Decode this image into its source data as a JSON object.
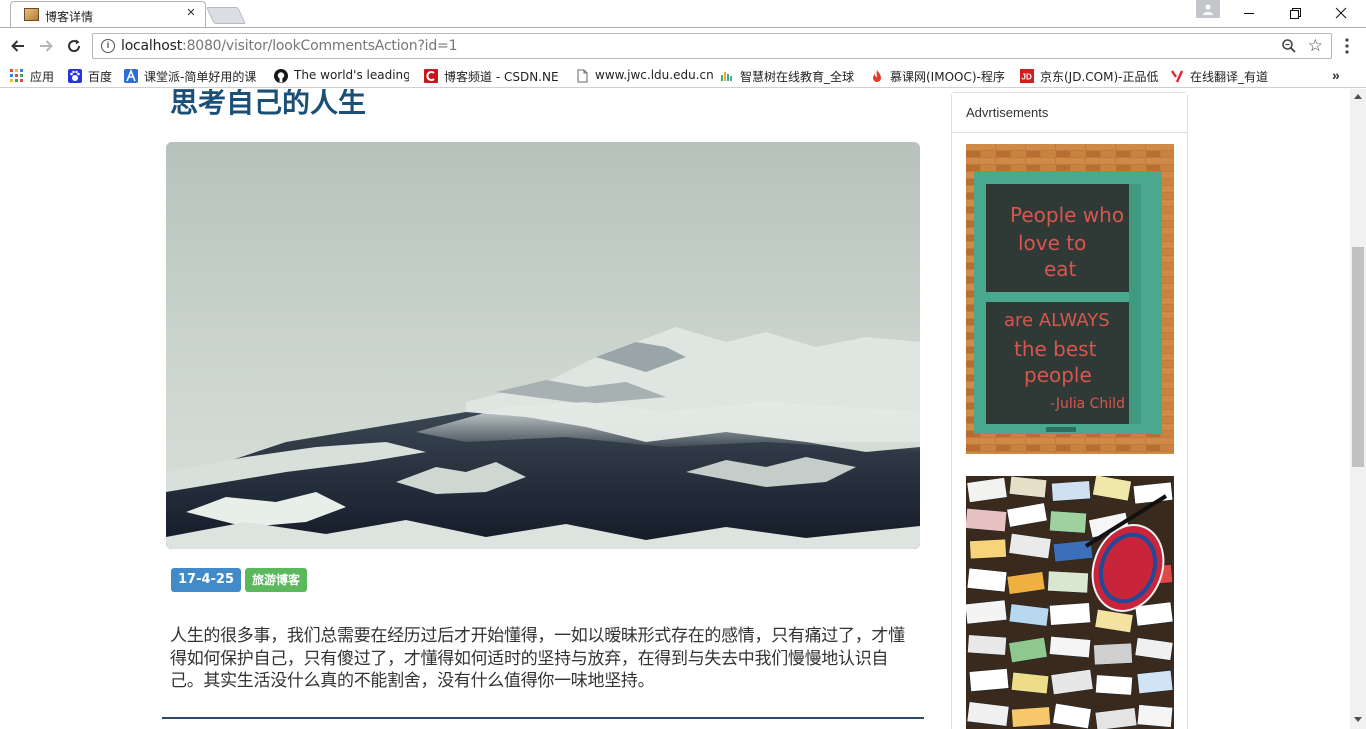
{
  "browser": {
    "tab_title": "博客详情",
    "url_host": "localhost",
    "url_rest": ":8080/visitor/lookCommentsAction?id=1"
  },
  "bookmarks": [
    {
      "label": "应用",
      "icon": "apps-grid-icon"
    },
    {
      "label": "百度",
      "icon": "baidu-paw-icon"
    },
    {
      "label": "课堂派-简单好用的课",
      "icon": "ketangpai-icon"
    },
    {
      "label": "The world's leading",
      "icon": "github-icon"
    },
    {
      "label": "博客频道 - CSDN.NE",
      "icon": "csdn-icon"
    },
    {
      "label": "www.jwc.ldu.edu.cn",
      "icon": "page-icon"
    },
    {
      "label": "智慧树在线教育_全球",
      "icon": "zhihuishu-icon"
    },
    {
      "label": "慕课网(IMOOC)-程序",
      "icon": "imooc-flame-icon"
    },
    {
      "label": "京东(JD.COM)-正品低",
      "icon": "jd-icon"
    },
    {
      "label": "在线翻译_有道",
      "icon": "youdao-icon"
    }
  ],
  "post": {
    "title": "思考自己的人生",
    "date": "17-4-25",
    "category": "旅游博客",
    "body": "人生的很多事，我们总需要在经历过后才开始懂得，一如以暧昧形式存在的感情，只有痛过了，才懂得如何保护自己，只有傻过了，才懂得如何适时的坚持与放弃，在得到与失去中我们慢慢地认识自己。其实生活没什么真的不能割舍，没有什么值得你一味地坚持。"
  },
  "sidebar": {
    "heading": "Advrtisements",
    "ad1_text": [
      "People who",
      "love to",
      "eat",
      "are ALWAYS",
      "the best",
      "people",
      "-Julia Child"
    ]
  },
  "colors": {
    "title": "#1a4f78",
    "label_date": "#428bca",
    "label_category": "#5cb85c",
    "ad1_frame": "#4aa88e",
    "ad1_chalk": "#d9554f"
  }
}
